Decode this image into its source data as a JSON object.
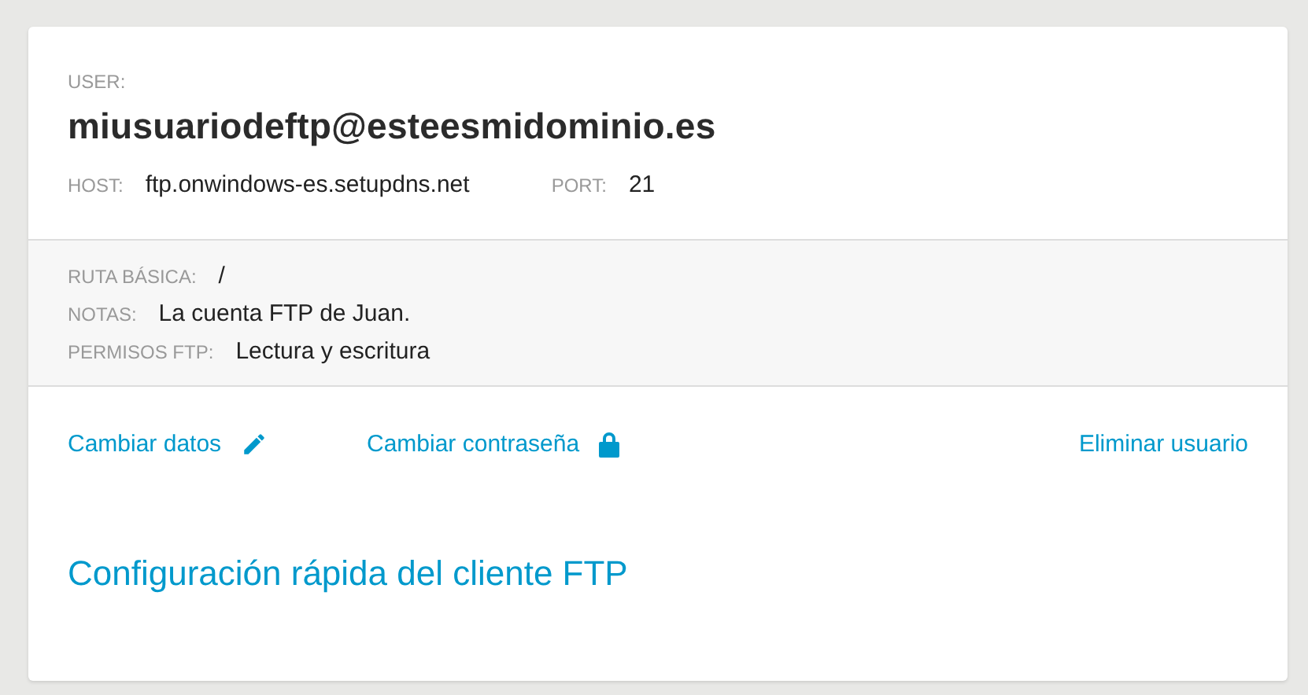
{
  "account": {
    "user_label": "USER:",
    "username": "miusuariodeftp@esteesmidominio.es",
    "connection": [
      {
        "label": "HOST:",
        "value": "ftp.onwindows-es.setupdns.net"
      },
      {
        "label": "PORT:",
        "value": "21"
      }
    ]
  },
  "details": [
    {
      "label": "RUTA BÁSICA:",
      "value": "/"
    },
    {
      "label": "NOTAS:",
      "value": "La cuenta FTP de Juan."
    },
    {
      "label": "PERMISOS FTP:",
      "value": "Lectura y escritura"
    }
  ],
  "actions": [
    {
      "label": "Cambiar datos",
      "kind": "edit"
    },
    {
      "label": "Cambiar contraseña",
      "kind": "password"
    },
    {
      "label": "Eliminar usuario",
      "kind": "delete"
    }
  ],
  "quick_setup": {
    "title": "Configuración rápida del cliente FTP"
  }
}
